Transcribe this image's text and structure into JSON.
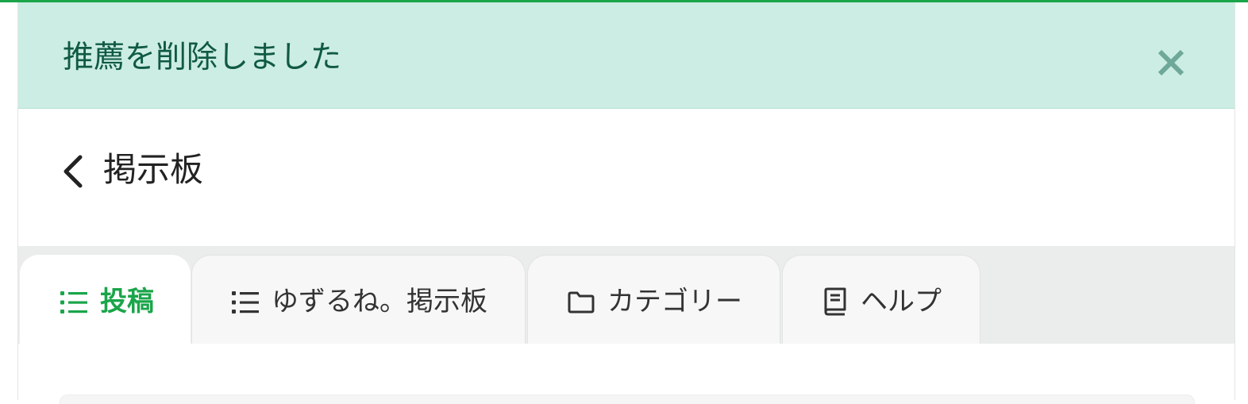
{
  "alert": {
    "message": "推薦を削除しました",
    "close_icon": "close-icon"
  },
  "header": {
    "back_icon": "chevron-left-icon",
    "title": "掲示板"
  },
  "tabs": [
    {
      "label": "投稿",
      "icon": "list-icon",
      "active": true
    },
    {
      "label": "ゆずるね。掲示板",
      "icon": "list-icon",
      "active": false
    },
    {
      "label": "カテゴリー",
      "icon": "folder-icon",
      "active": false
    },
    {
      "label": "ヘルプ",
      "icon": "book-icon",
      "active": false
    }
  ],
  "colors": {
    "accent": "#1aa54a",
    "alert_bg": "#ccede4",
    "alert_text": "#105a42",
    "tabbar_bg": "#ebedec"
  }
}
